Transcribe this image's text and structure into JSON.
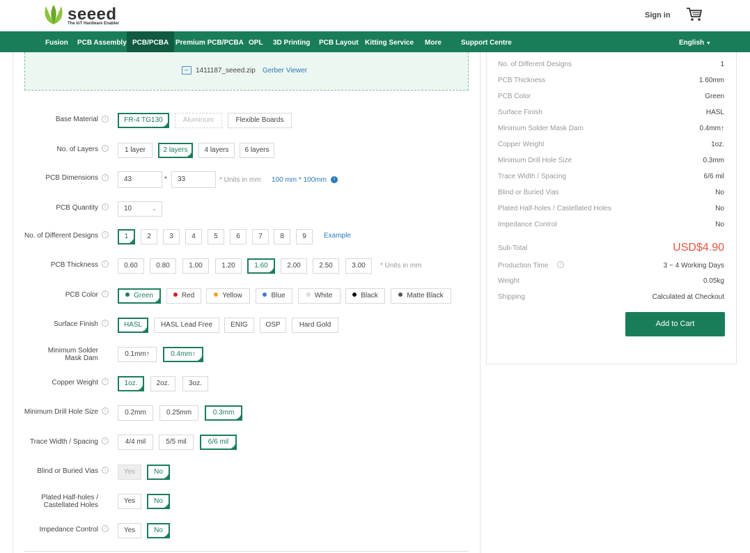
{
  "header": {
    "brand": "seeed",
    "tagline": "The IoT Hardware Enabler",
    "signin": "Sign in"
  },
  "nav": {
    "items": [
      "Fusion",
      "PCB Assembly",
      "PCB/PCBA",
      "Premium PCB/PCBA",
      "OPL",
      "3D Printing",
      "PCB Layout",
      "Kitting Service",
      "More",
      "Support Centre"
    ],
    "active": "PCB/PCBA",
    "language": "English"
  },
  "upload": {
    "filename": "1411187_seeed.zip",
    "viewer_link": "Gerber Viewer",
    "zip_badge": "ZIP"
  },
  "form": {
    "base_material": {
      "label": "Base Material",
      "options": [
        "FR-4 TG130",
        "Aluminum",
        "Flexible Boards"
      ],
      "selected": "FR-4 TG130"
    },
    "layers": {
      "label": "No. of Layers",
      "options": [
        "1 layer",
        "2 layers",
        "4 layers",
        "6 layers"
      ],
      "selected": "2 layers"
    },
    "dimensions": {
      "label": "PCB Dimensions",
      "width": "43",
      "height": "33",
      "sep": "*",
      "hint": "* Units in mm",
      "limit": "100 mm * 100mm"
    },
    "quantity": {
      "label": "PCB Quantity",
      "value": "10"
    },
    "designs": {
      "label": "No. of Different Designs",
      "options": [
        "1",
        "2",
        "3",
        "4",
        "5",
        "6",
        "7",
        "8",
        "9"
      ],
      "selected": "1",
      "example": "Example"
    },
    "thickness": {
      "label": "PCB Thickness",
      "options": [
        "0.60",
        "0.80",
        "1.00",
        "1.20",
        "1.60",
        "2.00",
        "2.50",
        "3.00"
      ],
      "selected": "1.60",
      "hint": "* Units in mm"
    },
    "color": {
      "label": "PCB Color",
      "options": [
        "Green",
        "Red",
        "Yellow",
        "Blue",
        "White",
        "Black",
        "Matte Black"
      ],
      "selected": "Green",
      "dots": [
        "#1a7d5a",
        "#d42020",
        "#f0a020",
        "#3a7ad8",
        "#e8e8e0",
        "#111111",
        "#555555"
      ]
    },
    "finish": {
      "label": "Surface Finish",
      "options": [
        "HASL",
        "HASL Lead Free",
        "ENIG",
        "OSP",
        "Hard Gold"
      ],
      "selected": "HASL"
    },
    "mask_dam": {
      "label_line1": "Minimum Solder",
      "label_line2": "Mask Dam",
      "options": [
        "0.1mm↑",
        "0.4mm↑"
      ],
      "selected": "0.4mm↑"
    },
    "copper": {
      "label": "Copper Weight",
      "options": [
        "1oz.",
        "2oz.",
        "3oz."
      ],
      "selected": "1oz."
    },
    "drill": {
      "label": "Minimum Drill Hole Size",
      "options": [
        "0.2mm",
        "0.25mm",
        "0.3mm"
      ],
      "selected": "0.3mm"
    },
    "trace": {
      "label": "Trace Width / Spacing",
      "options": [
        "4/4 mil",
        "5/5 mil",
        "6/6 mil"
      ],
      "selected": "6/6 mil"
    },
    "vias": {
      "label": "Blind or Buried Vias",
      "options": [
        "Yes",
        "No"
      ],
      "selected": "No"
    },
    "halfholes": {
      "label_line1": "Plated Half-holes /",
      "label_line2": "Castellated Holes",
      "options": [
        "Yes",
        "No"
      ],
      "selected": "No"
    },
    "impedance": {
      "label": "Impedance Control",
      "options": [
        "Yes",
        "No"
      ],
      "selected": "No"
    }
  },
  "summary": {
    "rows": [
      {
        "label": "No. of Different Designs",
        "value": "1"
      },
      {
        "label": "PCB Thickness",
        "value": "1.60mm"
      },
      {
        "label": "PCB Color",
        "value": "Green"
      },
      {
        "label": "Surface Finish",
        "value": "HASL"
      },
      {
        "label": "Minimum Solder Mask Dam",
        "value": "0.4mm↑"
      },
      {
        "label": "Copper Weight",
        "value": "1oz."
      },
      {
        "label": "Minimum Drill Hole Size",
        "value": "0.3mm"
      },
      {
        "label": "Trace Width / Spacing",
        "value": "6/6 mil"
      },
      {
        "label": "Blind or Buried Vias",
        "value": "No"
      },
      {
        "label": "Plated Half-holes / Castellated Holes",
        "value": "No"
      },
      {
        "label": "Impedance Control",
        "value": "No"
      }
    ],
    "subtotal_label": "Sub-Total",
    "subtotal_value": "USD$4.90",
    "production_label": "Production Time",
    "production_value": "3 ~ 4 Working Days",
    "weight_label": "Weight",
    "weight_value": "0.05kg",
    "shipping_label": "Shipping",
    "shipping_value": "Calculated at Checkout",
    "add_to_cart": "Add to Cart"
  },
  "colors": {
    "brand_green": "#1a7d5a",
    "price_red": "#e6533c",
    "link_blue": "#2a7ab8"
  }
}
